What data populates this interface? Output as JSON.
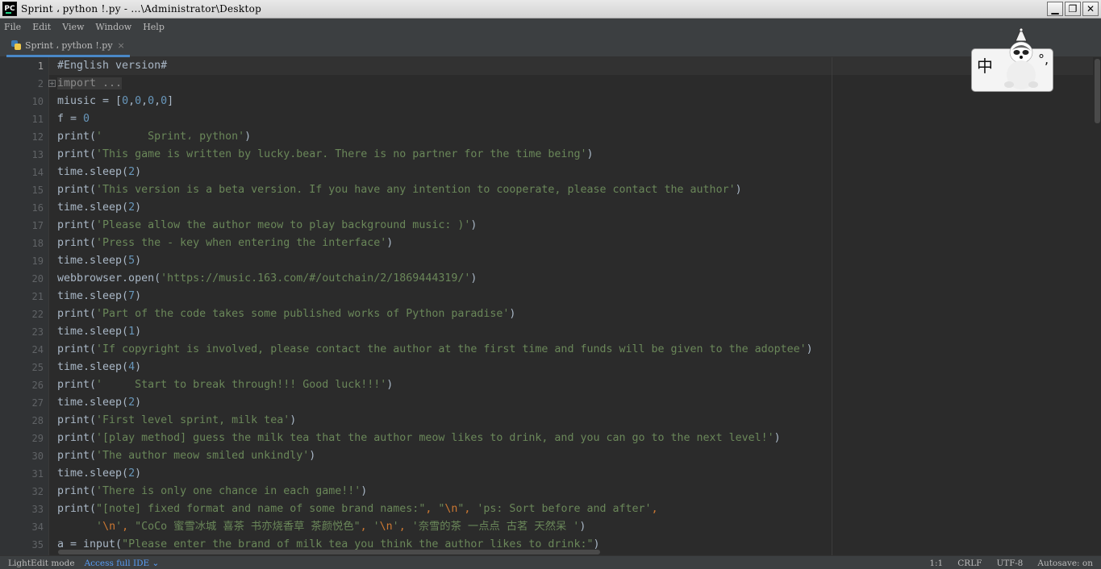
{
  "window": {
    "title": "Sprint ، python !.py - ...\\Administrator\\Desktop",
    "logo_text": "PC",
    "minimize": "▁",
    "restore": "❐",
    "close": "✕"
  },
  "menu": [
    "File",
    "Edit",
    "View",
    "Window",
    "Help"
  ],
  "tab": {
    "label": "Sprint ، python !.py",
    "close": "×"
  },
  "editor": {
    "line_numbers": [
      "1",
      "2",
      "10",
      "11",
      "12",
      "13",
      "14",
      "15",
      "16",
      "17",
      "18",
      "19",
      "20",
      "21",
      "22",
      "23",
      "24",
      "25",
      "26",
      "27",
      "28",
      "29",
      "30",
      "31",
      "32",
      "33",
      "34",
      "35"
    ],
    "fold_marker": "+"
  },
  "ime": {
    "char": "中",
    "punct": "°,"
  },
  "status": {
    "mode": "LightEdit mode",
    "access": "Access full IDE",
    "position": "1:1",
    "line_sep": "CRLF",
    "encoding": "UTF-8",
    "autosave": "Autosave: on"
  }
}
